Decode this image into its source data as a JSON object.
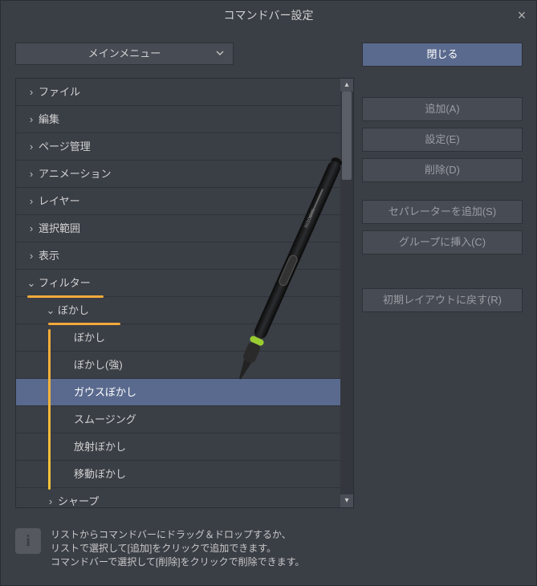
{
  "title": "コマンドバー設定",
  "dropdown": {
    "selected": "メインメニュー"
  },
  "tree": [
    {
      "kind": "group",
      "expanded": false,
      "label": "ファイル",
      "depth": 0
    },
    {
      "kind": "group",
      "expanded": false,
      "label": "編集",
      "depth": 0
    },
    {
      "kind": "group",
      "expanded": false,
      "label": "ページ管理",
      "depth": 0
    },
    {
      "kind": "group",
      "expanded": false,
      "label": "アニメーション",
      "depth": 0
    },
    {
      "kind": "group",
      "expanded": false,
      "label": "レイヤー",
      "depth": 0
    },
    {
      "kind": "group",
      "expanded": false,
      "label": "選択範囲",
      "depth": 0
    },
    {
      "kind": "group",
      "expanded": false,
      "label": "表示",
      "depth": 0
    },
    {
      "kind": "group",
      "expanded": true,
      "label": "フィルター",
      "depth": 0,
      "highlight": true
    },
    {
      "kind": "group",
      "expanded": true,
      "label": "ぼかし",
      "depth": 1,
      "highlight": true
    },
    {
      "kind": "item",
      "label": "ぼかし",
      "depth": 2
    },
    {
      "kind": "item",
      "label": "ぼかし(強)",
      "depth": 2
    },
    {
      "kind": "item",
      "label": "ガウスぼかし",
      "depth": 2,
      "selected": true
    },
    {
      "kind": "item",
      "label": "スムージング",
      "depth": 2
    },
    {
      "kind": "item",
      "label": "放射ぼかし",
      "depth": 2
    },
    {
      "kind": "item",
      "label": "移動ぼかし",
      "depth": 2
    },
    {
      "kind": "group",
      "expanded": false,
      "label": "シャープ",
      "depth": 1
    }
  ],
  "buttons": {
    "close": "閉じる",
    "add": "追加(A)",
    "settings": "設定(E)",
    "delete": "削除(D)",
    "add_separator": "セパレーターを追加(S)",
    "insert_group": "グループに挿入(C)",
    "reset": "初期レイアウトに戻す(R)"
  },
  "info": {
    "line1": "リストからコマンドバーにドラッグ＆ドロップするか、",
    "line2": "リストで選択して[追加]をクリックで追加できます。",
    "line3": "コマンドバーで選択して[削除]をクリックで削除できます。"
  },
  "icons": {
    "close_x": "×"
  }
}
